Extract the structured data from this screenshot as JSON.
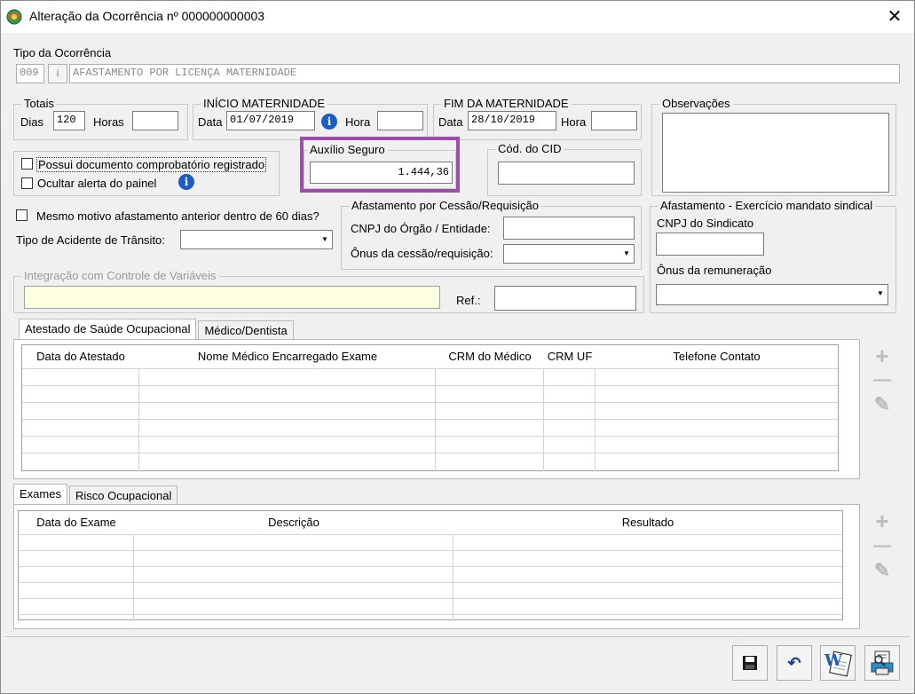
{
  "window": {
    "title": "Alteração da Ocorrência nº 000000000003",
    "close": "✕"
  },
  "tipo_ocorrencia": {
    "label": "Tipo da Ocorrência",
    "code": "009",
    "description": "AFASTAMENTO POR LICENÇA MATERNIDADE"
  },
  "totais": {
    "legend": "Totais",
    "dias_label": "Dias",
    "dias_value": "120",
    "horas_label": "Horas",
    "horas_value": ""
  },
  "inicio": {
    "legend": "INÍCIO MATERNIDADE",
    "data_label": "Data",
    "data_value": "01/07/2019",
    "hora_label": "Hora",
    "hora_value": ""
  },
  "fim": {
    "legend": "FIM DA MATERNIDADE",
    "data_label": "Data",
    "data_value": "28/10/2019",
    "hora_label": "Hora",
    "hora_value": ""
  },
  "observacoes": {
    "legend": "Observações",
    "value": ""
  },
  "checkboxes": {
    "possui_documento": "Possui documento comprobatório registrado",
    "ocultar_alerta": "Ocultar alerta do painel",
    "mesmo_motivo": "Mesmo motivo afastamento anterior dentro de 60 dias?"
  },
  "auxilio": {
    "legend": "Auxílio Seguro",
    "value": "1.444,36",
    "highlight_color": "#9b4fa6"
  },
  "cid": {
    "legend": "Cód. do CID",
    "value": ""
  },
  "acidente": {
    "label": "Tipo de Acidente de Trânsito:",
    "value": ""
  },
  "cessao": {
    "legend": "Afastamento por Cessão/Requisição",
    "cnpj_label": "CNPJ do Órgão / Entidade:",
    "cnpj_value": "",
    "onus_label": "Ônus da cessão/requisição:",
    "onus_value": ""
  },
  "sindical": {
    "legend": "Afastamento - Exercício mandato sindical",
    "cnpj_label": "CNPJ do Sindicato",
    "cnpj_value": "",
    "onus_label": "Ônus da remuneração",
    "onus_value": ""
  },
  "integracao": {
    "legend": "Integração com Controle de Variáveis",
    "value": "",
    "ref_label": "Ref.:",
    "ref_value": "",
    "field_color": "#ffffe1"
  },
  "atestado_tabs": [
    {
      "label": "Atestado de Saúde Ocupacional",
      "active": true
    },
    {
      "label": "Médico/Dentista",
      "active": false
    }
  ],
  "atestado_columns": [
    "Data do Atestado",
    "Nome Médico Encarregado Exame",
    "CRM do Médico",
    "CRM UF",
    "Telefone Contato"
  ],
  "exames_tabs": [
    {
      "label": "Exames",
      "active": true
    },
    {
      "label": "Risco Ocupacional",
      "active": false
    }
  ],
  "exames_columns": [
    "Data do Exame",
    "Descrição",
    "Resultado"
  ],
  "side_buttons": {
    "add": "+",
    "remove": "—",
    "edit": "✎"
  },
  "icons": {
    "app": "app-globe-icon",
    "info": "i",
    "save": "save-icon",
    "undo": "↶",
    "word": "W",
    "print": "print-preview-icon"
  }
}
